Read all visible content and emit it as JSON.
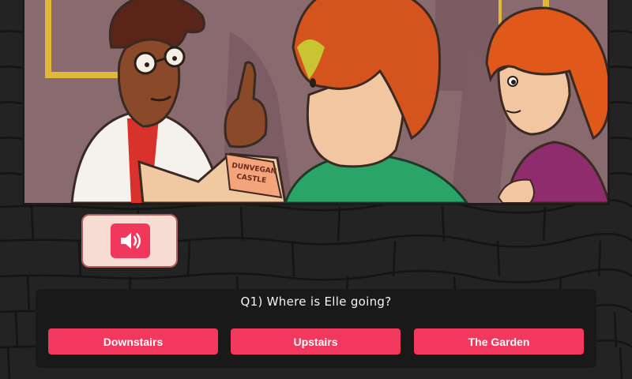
{
  "scene": {
    "sign_text_line1": "DUNVEGAN",
    "sign_text_line2": "CASTLE"
  },
  "audio": {
    "icon": "speaker-volume-icon"
  },
  "quiz": {
    "question": "Q1) Where is Elle going?",
    "answers": [
      {
        "label": "Downstairs"
      },
      {
        "label": "Upstairs"
      },
      {
        "label": "The Garden"
      }
    ]
  },
  "colors": {
    "accent": "#f2385d",
    "panel": "#1a1919",
    "bubble": "#f7dcd3",
    "wall": "#242323"
  }
}
